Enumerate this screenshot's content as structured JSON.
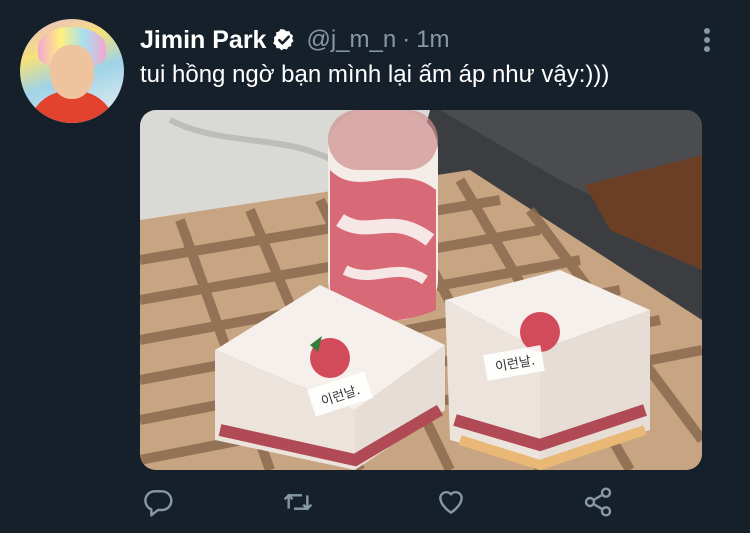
{
  "tweet": {
    "author_name": "Jimin Park",
    "handle": "@j_m_n",
    "separator": "·",
    "time": "1m",
    "text": "tui hồng ngờ bạn mình lại ấm áp như vậy:)))",
    "verified": true
  },
  "media": {
    "description_label_1": "이런날.",
    "description_label_2": "이런날."
  },
  "actions": {
    "icons": [
      "reply-icon",
      "retweet-icon",
      "like-icon",
      "share-icon"
    ]
  },
  "colors": {
    "background": "#15202b",
    "secondary_text": "#8899a6",
    "icon": "#8899a6"
  }
}
